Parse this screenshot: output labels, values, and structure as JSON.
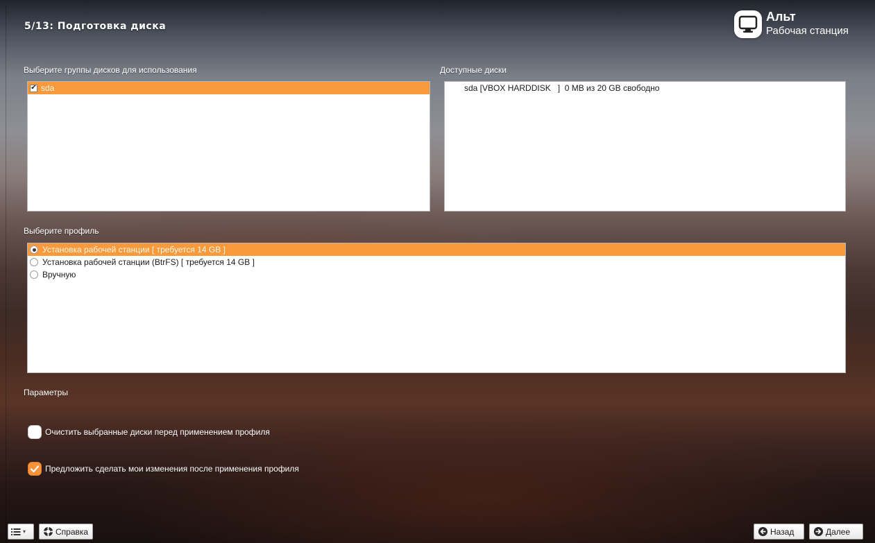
{
  "header": {
    "title": "5/13: Подготовка диска",
    "brand_name": "Альт",
    "brand_subtitle": "Рабочая станция"
  },
  "disk_groups": {
    "label": "Выберите группы дисков для использования",
    "items": [
      {
        "label": "sda",
        "checked": true,
        "selected": true
      }
    ]
  },
  "available_disks": {
    "label": "Доступные диски",
    "items": [
      {
        "text": "sda [VBOX HARDDISK   ]  0 MB из 20 GB свободно"
      }
    ]
  },
  "profile": {
    "label": "Выберите профиль",
    "options": [
      {
        "label": "Установка рабочей станции [ требуется 14 GB ]",
        "selected": true
      },
      {
        "label": "Установка рабочей станции (BtrFS) [ требуется 14 GB ]",
        "selected": false
      },
      {
        "label": "Вручную",
        "selected": false
      }
    ]
  },
  "parameters": {
    "label": "Параметры",
    "clear_disks": {
      "label": "Очистить выбранные диски перед применением профиля",
      "checked": false
    },
    "suggest_changes": {
      "label": "Предложить сделать мои изменения после применения профиля",
      "checked": true
    }
  },
  "footer": {
    "help_label": "Справка",
    "back_label": "Назад",
    "next_label": "Далее"
  },
  "colors": {
    "accent": "#f89a3b",
    "selection_text": "#fff7ec"
  }
}
